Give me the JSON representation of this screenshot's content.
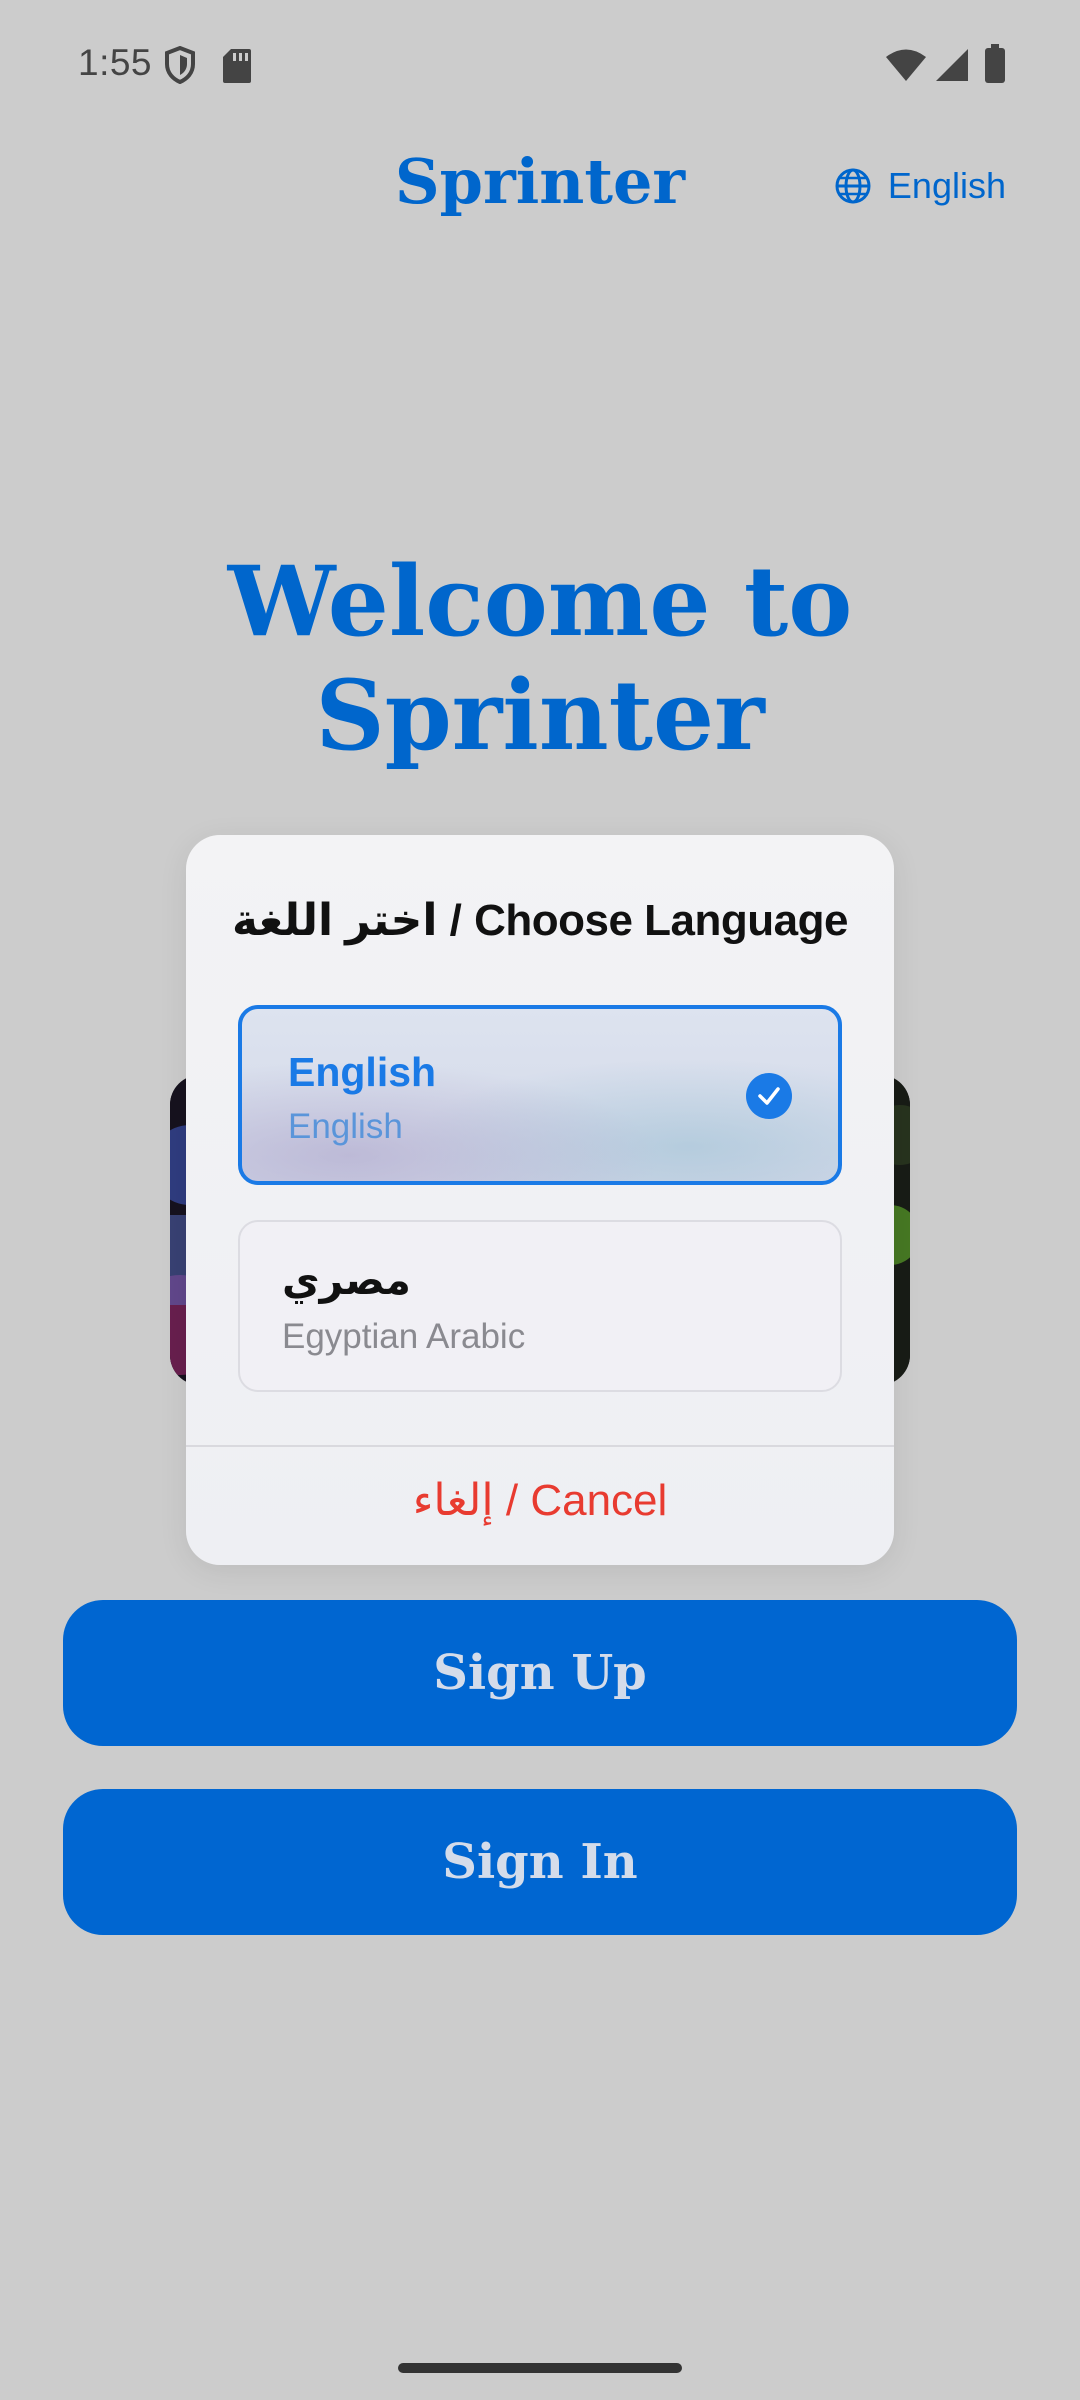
{
  "status_bar": {
    "time": "1:55",
    "icons": [
      "shield-icon",
      "sd-card-icon",
      "wifi-icon",
      "signal-icon",
      "battery-icon"
    ]
  },
  "header": {
    "title": "Sprinter",
    "language_label": "English",
    "language_icon": "globe-icon"
  },
  "welcome": {
    "line1": "Welcome to",
    "line2": "Sprinter"
  },
  "modal": {
    "title": "اختر اللغة / Choose Language",
    "options": [
      {
        "label": "English",
        "sublabel": "English",
        "selected": true
      },
      {
        "label": "مصري",
        "sublabel": "Egyptian Arabic",
        "selected": false
      }
    ],
    "cancel_label": "إلغاء / Cancel"
  },
  "buttons": {
    "signup": "Sign Up",
    "signin": "Sign In"
  },
  "colors": {
    "brand": "#0066cc",
    "button": "#0066d1",
    "cancel": "#e83b30",
    "selected": "#1a7ae6"
  }
}
